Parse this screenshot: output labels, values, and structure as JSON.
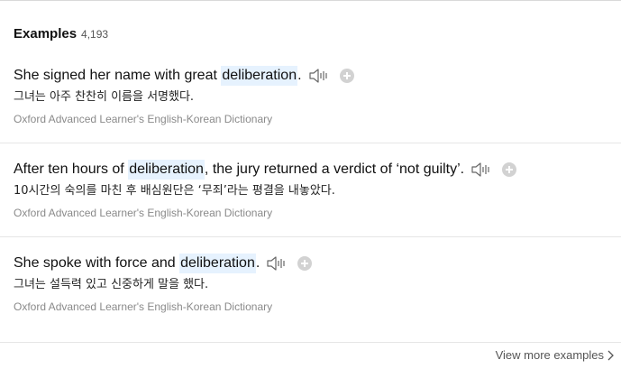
{
  "header": {
    "title": "Examples",
    "count": "4,193"
  },
  "examples": [
    {
      "before": "She signed her name with great ",
      "highlight": "deliberation",
      "after": ".",
      "translation": "그녀는 아주 찬찬히 이름을 서명했다.",
      "source": "Oxford Advanced Learner's English-Korean Dictionary"
    },
    {
      "before": "After ten hours of ",
      "highlight": "deliberation",
      "after": ", the jury returned a verdict of ‘not guilty’.",
      "translation": "10시간의 숙의를 마친 후 배심원단은 ‘무죄’라는 평결을 내놓았다.",
      "source": "Oxford Advanced Learner's English-Korean Dictionary"
    },
    {
      "before": "She spoke with force and ",
      "highlight": "deliberation",
      "after": ".",
      "translation": "그녀는 설득력 있고 신중하게 말을 했다.",
      "source": "Oxford Advanced Learner's English-Korean Dictionary"
    }
  ],
  "footer": {
    "view_more": "View more examples"
  },
  "icons": {
    "speaker": "speaker-icon",
    "add": "plus-icon",
    "chevron": "chevron-right-icon"
  },
  "colors": {
    "highlight": "#e6f2fe",
    "add_button": "#d2d2d2",
    "source_text": "#8a8a8a"
  }
}
